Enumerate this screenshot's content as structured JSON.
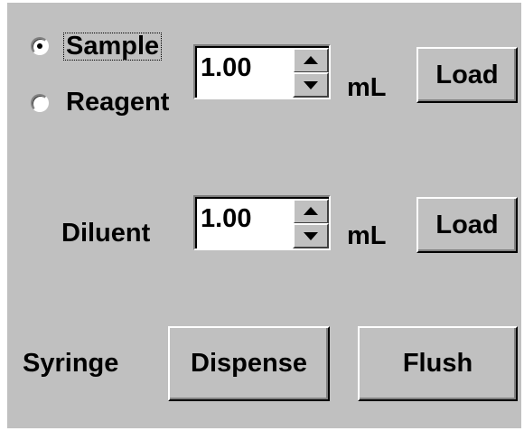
{
  "source": {
    "options": [
      {
        "label": "Sample",
        "selected": true
      },
      {
        "label": "Reagent",
        "selected": false
      }
    ],
    "volume": "1.00",
    "unit": "mL",
    "load_label": "Load"
  },
  "diluent": {
    "label": "Diluent",
    "volume": "1.00",
    "unit": "mL",
    "load_label": "Load"
  },
  "syringe": {
    "label": "Syringe",
    "dispense_label": "Dispense",
    "flush_label": "Flush"
  },
  "icons": {
    "spin_up": "arrow-up-icon",
    "spin_down": "arrow-down-icon",
    "radio_selected": "radio-selected-icon",
    "radio_unselected": "radio-unselected-icon"
  },
  "colors": {
    "panel": "#c0c0c0",
    "field": "#ffffff",
    "text": "#000000"
  }
}
